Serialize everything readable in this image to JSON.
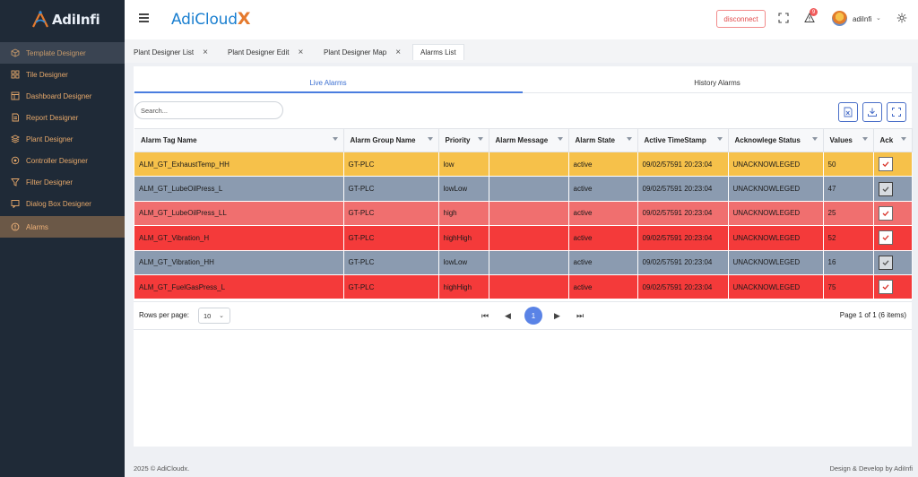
{
  "sidebar": {
    "logo": "AdiInfi",
    "items": [
      {
        "label": "Template Designer",
        "icon": "cube-icon"
      },
      {
        "label": "Tile Designer",
        "icon": "grid-icon"
      },
      {
        "label": "Dashboard Designer",
        "icon": "dashboard-icon"
      },
      {
        "label": "Report Designer",
        "icon": "report-icon"
      },
      {
        "label": "Plant Designer",
        "icon": "layers-icon"
      },
      {
        "label": "Controller Designer",
        "icon": "controller-icon"
      },
      {
        "label": "Filter Designer",
        "icon": "filter-icon"
      },
      {
        "label": "Dialog Box Designer",
        "icon": "dialog-icon"
      },
      {
        "label": "Alarms",
        "icon": "alert-circle-icon"
      }
    ]
  },
  "header": {
    "brand": "AdiCloud",
    "brand_x": "X",
    "disconnect_label": "disconnect",
    "notification_count": "9",
    "username": "adiInfi"
  },
  "page_tabs": [
    {
      "label": "Plant Designer List"
    },
    {
      "label": "Plant Designer Edit"
    },
    {
      "label": "Plant Designer Map"
    },
    {
      "label": "Alarms List"
    }
  ],
  "subtabs": {
    "live": "Live Alarms",
    "history": "History Alarms"
  },
  "search": {
    "placeholder": "Search..."
  },
  "table": {
    "columns": [
      "Alarm Tag Name",
      "Alarm Group Name",
      "Priority",
      "Alarm Message",
      "Alarm State",
      "Active TimeStamp",
      "Acknowlege Status",
      "Values",
      "Ack"
    ],
    "rows": [
      {
        "tag": "ALM_GT_ExhaustTemp_HH",
        "group": "GT-PLC",
        "priority": "low",
        "message": "",
        "state": "active",
        "timestamp": "09/02/57591 20:23:04",
        "ack_status": "UNACKNOWLEGED",
        "value": "50"
      },
      {
        "tag": "ALM_GT_LubeOilPress_L",
        "group": "GT-PLC",
        "priority": "lowLow",
        "message": "",
        "state": "active",
        "timestamp": "09/02/57591 20:23:04",
        "ack_status": "UNACKNOWLEGED",
        "value": "47"
      },
      {
        "tag": "ALM_GT_LubeOilPress_LL",
        "group": "GT-PLC",
        "priority": "high",
        "message": "",
        "state": "active",
        "timestamp": "09/02/57591 20:23:04",
        "ack_status": "UNACKNOWLEGED",
        "value": "25"
      },
      {
        "tag": "ALM_GT_Vibration_H",
        "group": "GT-PLC",
        "priority": "highHigh",
        "message": "",
        "state": "active",
        "timestamp": "09/02/57591 20:23:04",
        "ack_status": "UNACKNOWLEGED",
        "value": "52"
      },
      {
        "tag": "ALM_GT_Vibration_HH",
        "group": "GT-PLC",
        "priority": "lowLow",
        "message": "",
        "state": "active",
        "timestamp": "09/02/57591 20:23:04",
        "ack_status": "UNACKNOWLEGED",
        "value": "16"
      },
      {
        "tag": "ALM_GT_FuelGasPress_L",
        "group": "GT-PLC",
        "priority": "highHigh",
        "message": "",
        "state": "active",
        "timestamp": "09/02/57591 20:23:04",
        "ack_status": "UNACKNOWLEGED",
        "value": "75"
      }
    ]
  },
  "pager": {
    "rows_per_page_label": "Rows per page:",
    "rows_per_page": "10",
    "current_page": "1",
    "page_info": "Page 1 of 1 (6 items)"
  },
  "footer": {
    "left": "2025 © AdiCloudx.",
    "right": "Design & Develop by AdiInfi"
  },
  "colors": {
    "low": "#f6c14a",
    "lowLow": "#8b9bb0",
    "high": "#f06f6f",
    "highHigh": "#f43a3a",
    "accent": "#4a7ddf",
    "sidebar_bg": "#1f2a37"
  }
}
